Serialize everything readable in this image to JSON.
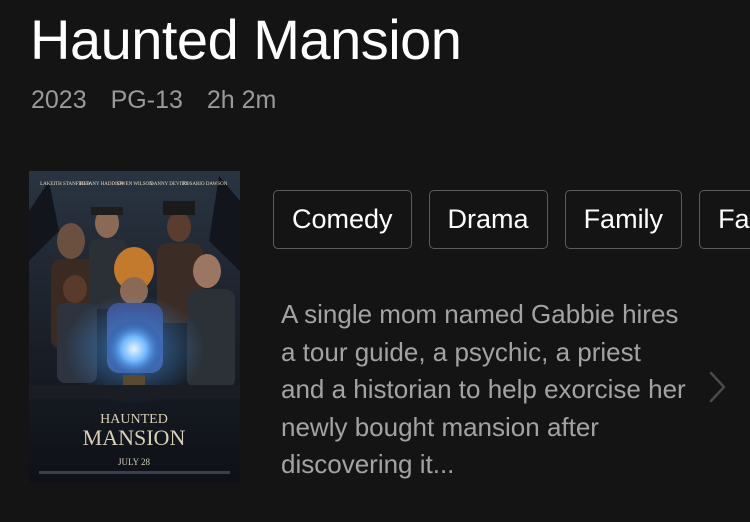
{
  "movie": {
    "title": "Haunted Mansion",
    "year": "2023",
    "rating": "PG-13",
    "runtime": "2h 2m"
  },
  "poster": {
    "icon": "movie-poster-image",
    "cast": [
      "LAKEITH STANFIELD",
      "TIFFANY HADDISH",
      "OWEN WILSON",
      "DANNY DEVITO",
      "ROSARIO DAWSON"
    ],
    "logo_line1": "HAUNTED",
    "logo_line2": "MANSION",
    "release": "JULY 28"
  },
  "genres": [
    "Comedy",
    "Drama",
    "Family",
    "Fantasy"
  ],
  "description": "A single mom named Gabbie hires a tour guide, a psychic, a priest and a historian to help exorcise her newly bought mansion after discovering it...",
  "more_icon": "chevron-right-icon",
  "colors": {
    "background": "#141414",
    "meta_text": "#9a9a9a",
    "description_text": "#a3a3a3",
    "chip_border": "#5c5c5c",
    "chevron": "#4a4a4a"
  }
}
